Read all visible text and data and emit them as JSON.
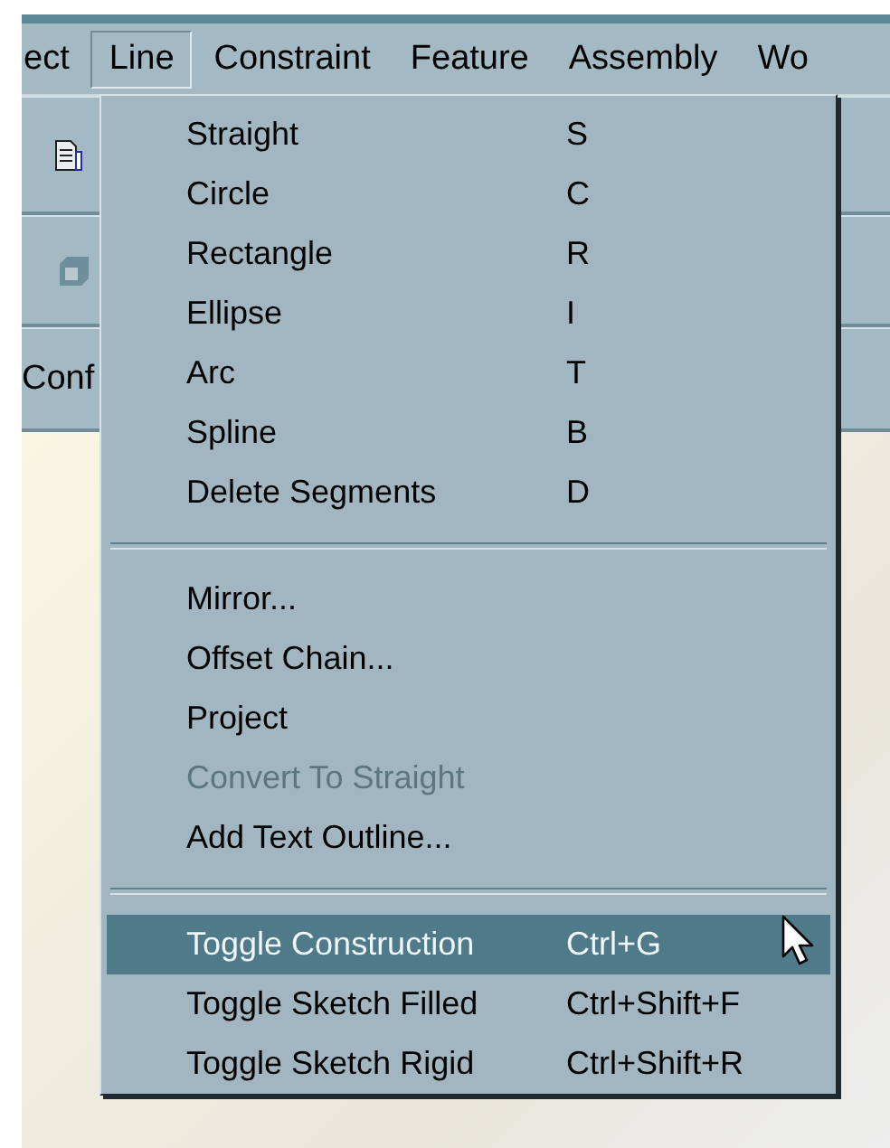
{
  "menubar": [
    {
      "label": "ect",
      "selected": false
    },
    {
      "label": "Line",
      "selected": true
    },
    {
      "label": "Constraint",
      "selected": false
    },
    {
      "label": "Feature",
      "selected": false
    },
    {
      "label": "Assembly",
      "selected": false
    },
    {
      "label": "Wo",
      "selected": false
    }
  ],
  "toolbar": {
    "label": "Conf"
  },
  "menu": {
    "items": [
      {
        "kind": "item",
        "label": "Straight",
        "shortcut": "S",
        "disabled": false,
        "selected": false
      },
      {
        "kind": "item",
        "label": "Circle",
        "shortcut": "C",
        "disabled": false,
        "selected": false
      },
      {
        "kind": "item",
        "label": "Rectangle",
        "shortcut": "R",
        "disabled": false,
        "selected": false
      },
      {
        "kind": "item",
        "label": "Ellipse",
        "shortcut": "I",
        "disabled": false,
        "selected": false
      },
      {
        "kind": "item",
        "label": "Arc",
        "shortcut": "T",
        "disabled": false,
        "selected": false
      },
      {
        "kind": "item",
        "label": "Spline",
        "shortcut": "B",
        "disabled": false,
        "selected": false
      },
      {
        "kind": "item",
        "label": "Delete Segments",
        "shortcut": "D",
        "disabled": false,
        "selected": false
      },
      {
        "kind": "separator"
      },
      {
        "kind": "item",
        "label": "Mirror...",
        "disabled": false,
        "selected": false
      },
      {
        "kind": "item",
        "label": "Offset Chain...",
        "disabled": false,
        "selected": false
      },
      {
        "kind": "item",
        "label": "Project",
        "disabled": false,
        "selected": false
      },
      {
        "kind": "item",
        "label": "Convert To Straight",
        "disabled": true,
        "selected": false
      },
      {
        "kind": "item",
        "label": "Add Text Outline...",
        "disabled": false,
        "selected": false
      },
      {
        "kind": "separator"
      },
      {
        "kind": "item",
        "label": "Toggle Construction",
        "shortcut": "Ctrl+G",
        "disabled": false,
        "selected": true
      },
      {
        "kind": "item",
        "label": "Toggle Sketch Filled",
        "shortcut": "Ctrl+Shift+F",
        "disabled": false,
        "selected": false
      },
      {
        "kind": "item",
        "label": "Toggle Sketch Rigid",
        "shortcut": "Ctrl+Shift+R",
        "disabled": false,
        "selected": false
      }
    ]
  }
}
